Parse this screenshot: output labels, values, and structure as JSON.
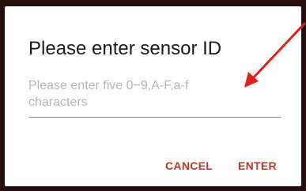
{
  "dialog": {
    "title": "Please enter sensor ID",
    "input": {
      "value": "",
      "placeholder": "Please enter five 0−9,A-F,a-f characters"
    },
    "buttons": {
      "cancel_label": "CANCEL",
      "enter_label": "ENTER"
    }
  },
  "colors": {
    "accent": "#b63a2b",
    "annotation_arrow": "#e0201b",
    "backdrop": "#2a0f0c",
    "placeholder": "#b4b4b4"
  },
  "annotation": {
    "icon": "red-arrow-icon"
  }
}
